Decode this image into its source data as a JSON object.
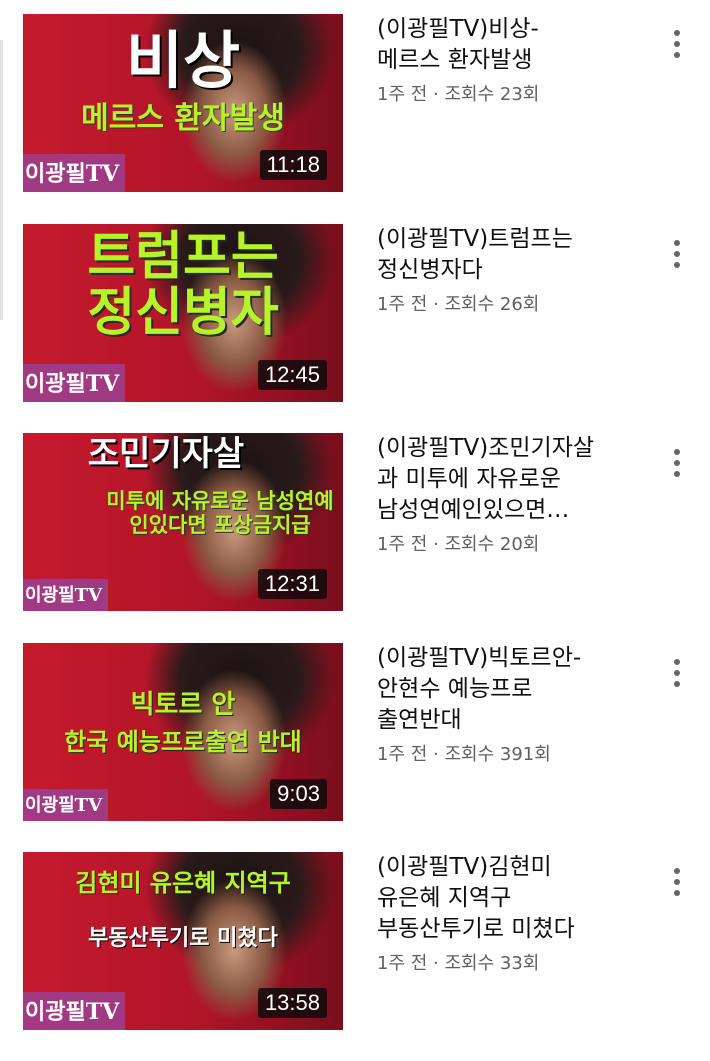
{
  "videos": [
    {
      "thumb_main": "비상",
      "thumb_banner": "메르스 환자발생",
      "brand": "이광필TV",
      "duration": "11:18",
      "title_line1": "(이광필TV)비상-",
      "title_line2": "메르스 환자발생",
      "title_line3": "",
      "age": "1주 전",
      "views": "조회수 23회"
    },
    {
      "thumb_main": "트럼프는",
      "thumb_banner": "정신병자",
      "brand": "이광필TV",
      "duration": "12:45",
      "title_line1": "(이광필TV)트럼프는",
      "title_line2": "정신병자다",
      "title_line3": "",
      "age": "1주 전",
      "views": "조회수 26회"
    },
    {
      "thumb_main": "조민기자살",
      "thumb_banner": "미투에 자유로운 남성연예인있다면 포상금지급",
      "brand": "이광필TV",
      "duration": "12:31",
      "title_line1": "(이광필TV)조민기자살",
      "title_line2": "과 미투에 자유로운",
      "title_line3": "남성연예인있으면…",
      "age": "1주 전",
      "views": "조회수 20회"
    },
    {
      "thumb_main": "빅토르 안",
      "thumb_banner": "한국 예능프로출연 반대",
      "brand": "이광필TV",
      "duration": "9:03",
      "title_line1": "(이광필TV)빅토르안-",
      "title_line2": "안현수 예능프로",
      "title_line3": "출연반대",
      "age": "1주 전",
      "views": "조회수 391회"
    },
    {
      "thumb_main": "김현미 유은혜 지역구",
      "thumb_banner": "부동산투기로 미쳤다",
      "brand": "이광필TV",
      "duration": "13:58",
      "title_line1": "(이광필TV)김현미",
      "title_line2": "유은혜 지역구",
      "title_line3": "부동산투기로 미쳤다",
      "age": "1주 전",
      "views": "조회수 33회"
    }
  ],
  "meta_separator": "·",
  "colors": {
    "thumb_red": "#c51a2e",
    "thumb_green_text": "#b6f42a",
    "brand_purple": "#9646a0",
    "title": "#101010",
    "subtitle": "#606060"
  },
  "icons": [
    "more-vertical-icon"
  ]
}
